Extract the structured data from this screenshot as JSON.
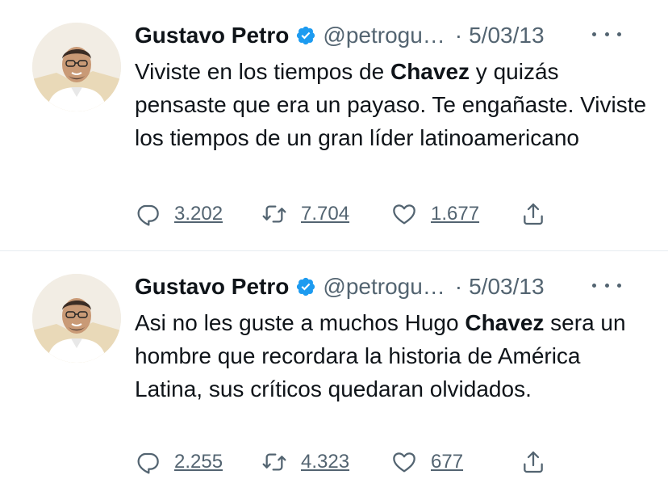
{
  "tweets": [
    {
      "author": {
        "name": "Gustavo Petro",
        "handle": "@petrogu…",
        "verified": true
      },
      "date": "5/03/13",
      "text_parts": [
        {
          "text": "Viviste en los tiempos de ",
          "bold": false
        },
        {
          "text": "Chavez",
          "bold": true
        },
        {
          "text": " y quizás pensaste que era un payaso. Te engañaste. Viviste los tiempos de un gran líder latinoamericano",
          "bold": false
        }
      ],
      "stats": {
        "replies": "3.202",
        "retweets": "7.704",
        "likes": "1.677"
      }
    },
    {
      "author": {
        "name": "Gustavo Petro",
        "handle": "@petrogu…",
        "verified": true
      },
      "date": "5/03/13",
      "text_parts": [
        {
          "text": "Asi no les guste a muchos Hugo ",
          "bold": false
        },
        {
          "text": "Chavez",
          "bold": true
        },
        {
          "text": " sera un hombre que recordara la historia de América Latina, sus críticos quedaran olvidados.",
          "bold": false
        }
      ],
      "stats": {
        "replies": "2.255",
        "retweets": "4.323",
        "likes": "677"
      }
    }
  ],
  "separator": "·",
  "icons": {
    "verified": "verified-badge-icon",
    "more": "more-dots-icon",
    "reply": "reply-icon",
    "retweet": "retweet-icon",
    "like": "heart-icon",
    "share": "share-icon"
  },
  "colors": {
    "text": "#0f1419",
    "secondary": "#536471",
    "verified": "#1d9bf0",
    "divider": "#e6ecf0"
  }
}
